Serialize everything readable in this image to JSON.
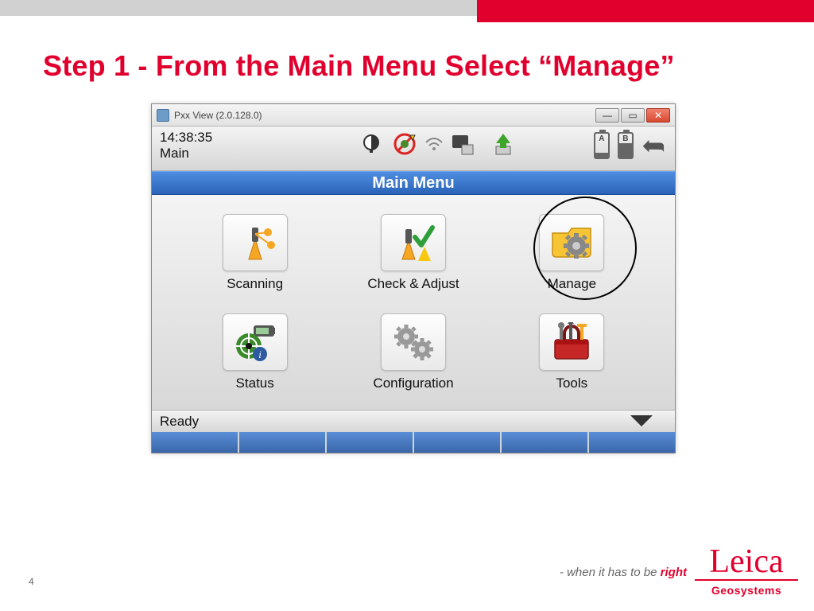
{
  "slide": {
    "heading": "Step 1 -  From the Main Menu Select “Manage”",
    "page_number": "4",
    "tagline_prefix": "- when it has to be ",
    "tagline_accent": "right",
    "logo_script": "Leica",
    "logo_sub": "Geosystems"
  },
  "window": {
    "title": "Pxx View (2.0.128.0)",
    "time": "14:38:35",
    "context": "Main",
    "bluebar": "Main Menu",
    "status": "Ready",
    "battery_a": "A",
    "battery_b": "B",
    "items": [
      {
        "label": "Scanning"
      },
      {
        "label": "Check & Adjust"
      },
      {
        "label": "Manage"
      },
      {
        "label": "Status"
      },
      {
        "label": "Configuration"
      },
      {
        "label": "Tools"
      }
    ]
  }
}
